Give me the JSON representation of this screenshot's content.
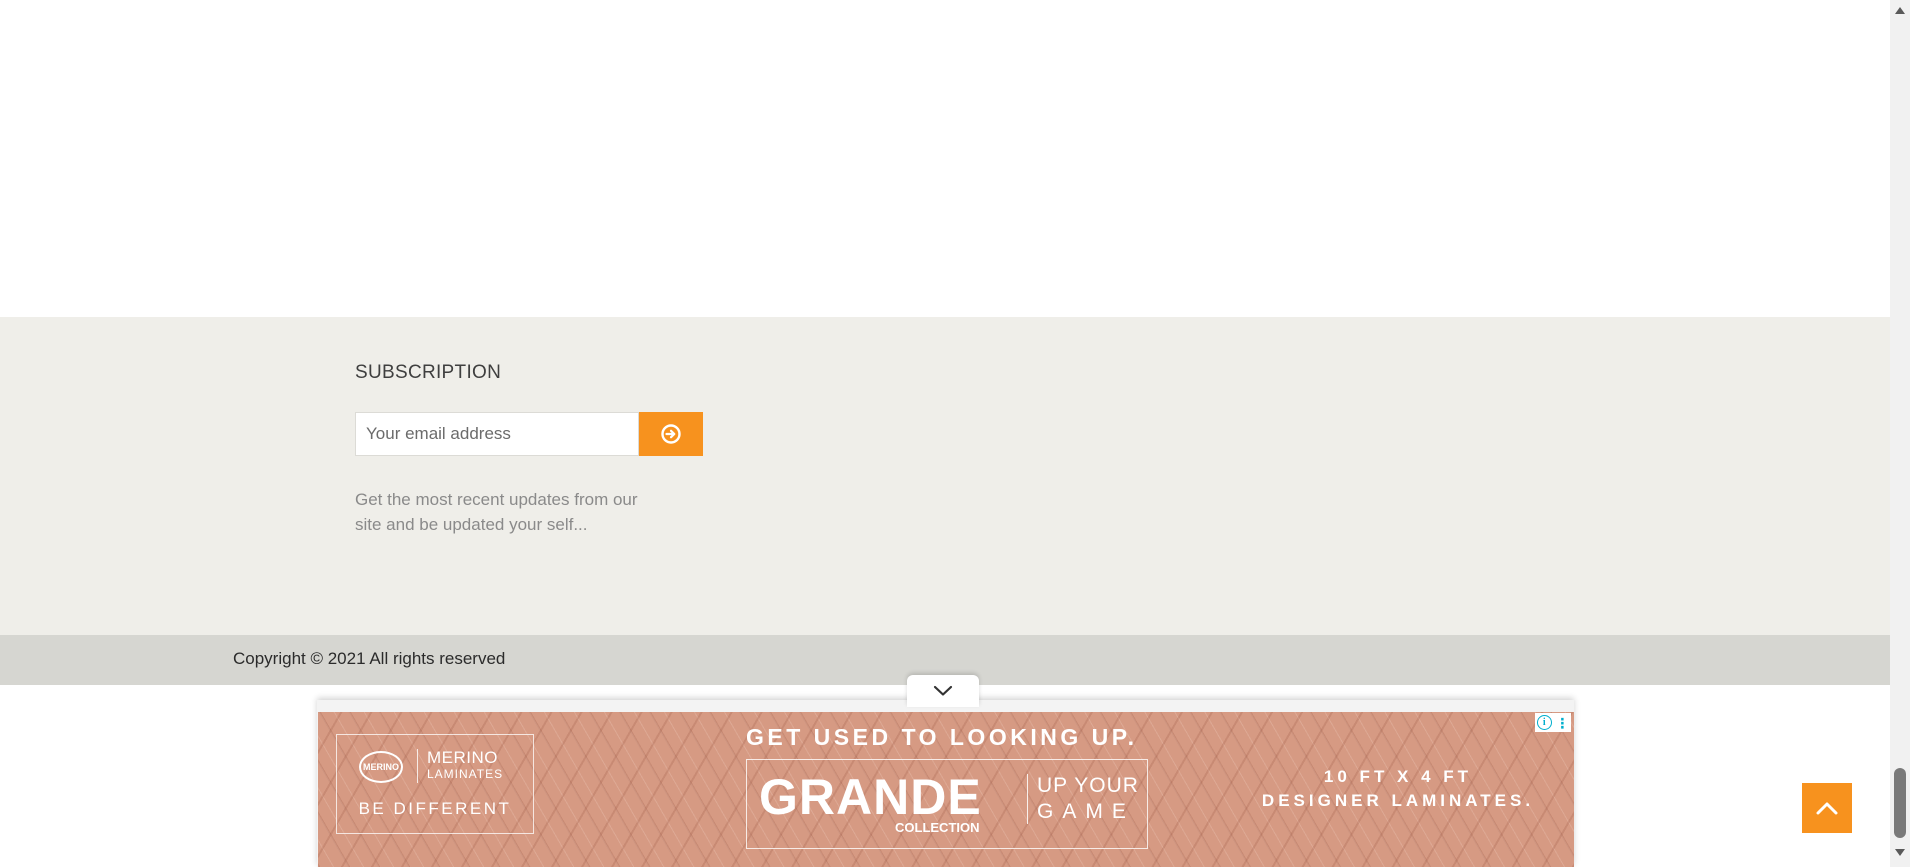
{
  "subscription": {
    "title": "SUBSCRIPTION",
    "email_placeholder": "Your email address",
    "submit_icon": "arrow-circle-right-icon",
    "description": "Get the most recent updates from our site and be updated your self..."
  },
  "footer": {
    "copyright": "Copyright © 2021 All rights reserved"
  },
  "ad": {
    "collapse_icon": "chevron-down-icon",
    "brand_logo_text": "MERINO",
    "brand_name": "MERINO",
    "brand_sub": "LAMINATES",
    "brand_tagline": "BE DIFFERENT",
    "headline": "GET USED TO LOOKING UP.",
    "product_name": "GRANDE",
    "product_sub": "COLLECTION",
    "slogan_line1": "UP YOUR",
    "slogan_line2": "GAME",
    "spec_line1": "10 FT X 4 FT",
    "spec_line2": "DESIGNER LAMINATES.",
    "info_icon_glyph": "i",
    "menu_glyph": "⋮"
  },
  "scroll_top": {
    "icon": "chevron-up-icon"
  },
  "colors": {
    "accent": "#f7921e",
    "footer_bg": "#efeee9",
    "copyright_bg": "#d6d6d1",
    "ad_bg": "#d69a83",
    "adchoices": "#00aecd"
  }
}
